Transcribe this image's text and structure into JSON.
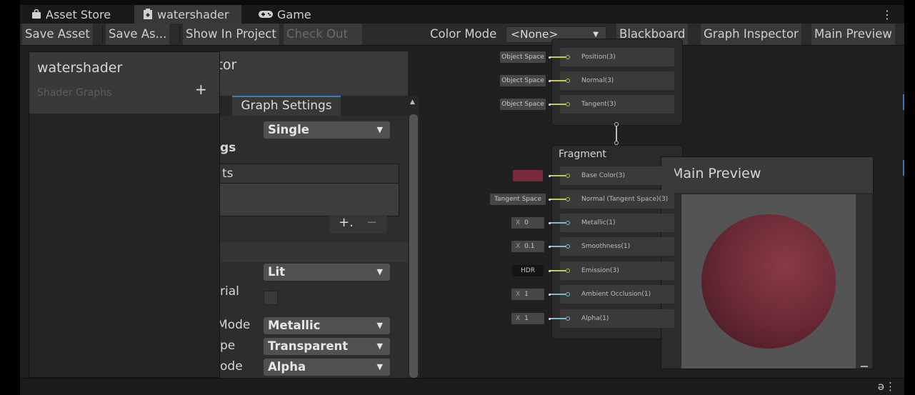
{
  "tabs": [
    {
      "label": "Asset Store",
      "icon": "bag-icon"
    },
    {
      "label": "watershader",
      "icon": "shader-graph-icon",
      "active": true
    },
    {
      "label": "Game",
      "icon": "gamepad-icon"
    }
  ],
  "toolbar": {
    "save_asset": "Save Asset",
    "save_as": "Save As...",
    "show_in_project": "Show In Project",
    "check_out": "Check Out",
    "color_mode_label": "Color Mode",
    "color_mode_value": "<None>",
    "blackboard": "Blackboard",
    "graph_inspector": "Graph Inspector",
    "main_preview": "Main Preview"
  },
  "blackboard": {
    "title": "watershader",
    "subtitle": "Shader Graphs",
    "add": "+"
  },
  "inspector": {
    "title_partial": "ctor",
    "tab": "Graph Settings",
    "precision_value": "Single",
    "section_partial": "gs",
    "targets_partial": "ts",
    "list_add": "+.",
    "list_remove": "−",
    "material_value": "Lit",
    "allow_material_partial": "rial",
    "workflow_partial": "Mode",
    "workflow_value": "Metallic",
    "surface_partial": "pe",
    "surface_value": "Transparent",
    "blend_partial": "ode",
    "blend_value": "Alpha"
  },
  "vertex_slots": [
    {
      "space": "Object Space",
      "label": "Position(3)"
    },
    {
      "space": "Object Space",
      "label": "Normal(3)"
    },
    {
      "space": "Object Space",
      "label": "Tangent(3)"
    }
  ],
  "fragment": {
    "title": "Fragment",
    "slots": [
      {
        "label": "Base Color(3)",
        "kind": "color",
        "color": "#7a2a3a"
      },
      {
        "label": "Normal (Tangent Space)(3)",
        "kind": "text",
        "value": "Tangent Space"
      },
      {
        "label": "Metallic(1)",
        "kind": "x",
        "value": "0"
      },
      {
        "label": "Smoothness(1)",
        "kind": "x",
        "value": "0.1"
      },
      {
        "label": "Emission(3)",
        "kind": "hdr",
        "value": "HDR"
      },
      {
        "label": "Ambient Occlusion(1)",
        "kind": "x",
        "value": "1"
      },
      {
        "label": "Alpha(1)",
        "kind": "x",
        "value": "1"
      }
    ]
  },
  "main_preview": {
    "title": "Main Preview",
    "sphere_color": "#6b2a35"
  },
  "colors": {
    "accent": "#3a79bb",
    "port_yellow": "#c7c75a",
    "port_blue": "#7fb9d8"
  }
}
